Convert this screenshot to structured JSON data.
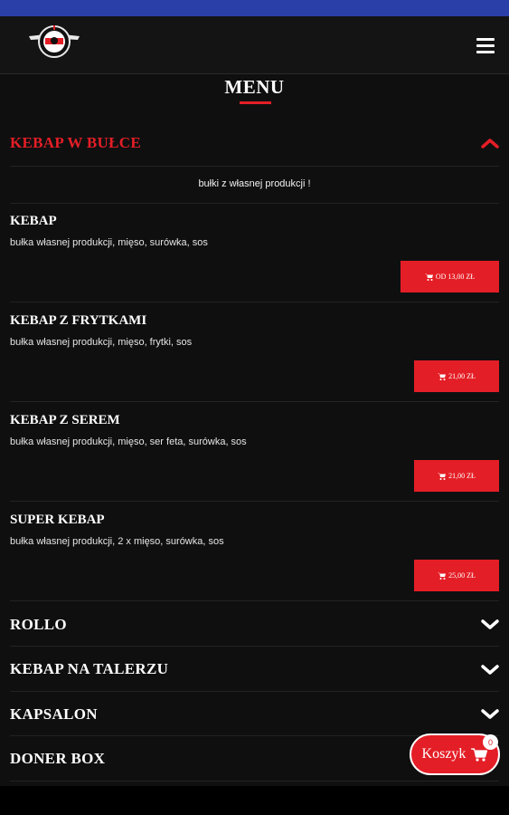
{
  "menu": {
    "title": "MENU"
  },
  "categories": [
    {
      "name": "KEBAP W BUŁCE",
      "intro": "bułki z własnej produkcji !"
    },
    {
      "name": "ROLLO"
    },
    {
      "name": "KEBAP NA TALERZU"
    },
    {
      "name": "KAPSALON"
    },
    {
      "name": "DONER BOX"
    }
  ],
  "items": [
    {
      "name": "KEBAP",
      "desc": "bułka własnej produkcji, mięso, surówka, sos",
      "price": "OD 13,00 ZŁ"
    },
    {
      "name": "KEBAP Z FRYTKAMI",
      "desc": "bułka własnej produkcji, mięso, frytki, sos",
      "price": "21,00 ZŁ"
    },
    {
      "name": "KEBAP Z SEREM",
      "desc": "bułka własnej produkcji, mięso, ser feta, surówka, sos",
      "price": "21,00 ZŁ"
    },
    {
      "name": "SUPER KEBAP",
      "desc": "bułka własnej produkcji, 2 x mięso, surówka, sos",
      "price": "25,00 ZŁ"
    }
  ],
  "cart": {
    "label": "Koszyk",
    "count": "0"
  },
  "icons": {
    "logo": "brand-logo",
    "menu": "hamburger-icon",
    "cart": "cart-icon",
    "chevron_up": "chevron-up-icon",
    "chevron_down": "chevron-down-icon"
  },
  "colors": {
    "accent": "#e41e26",
    "statusbar": "#2b3fa8",
    "header": "#141414",
    "background": "#0f0f10"
  }
}
